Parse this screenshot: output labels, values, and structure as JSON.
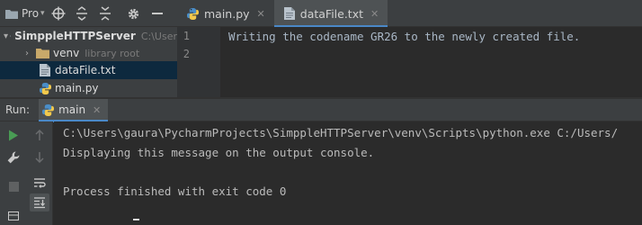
{
  "project_toolbar": {
    "label": "Pro",
    "icons": [
      "folder-icon",
      "crosshair-icon",
      "expand-all-icon",
      "collapse-all-icon",
      "gear-icon",
      "minimize-icon"
    ]
  },
  "editor_tabs": [
    {
      "label": "main.py",
      "icon": "python-file-icon",
      "active": false
    },
    {
      "label": "dataFile.txt",
      "icon": "text-file-icon",
      "active": true
    }
  ],
  "project_tree": {
    "root": {
      "name": "SimppleHTTPServer",
      "path": "C:\\User"
    },
    "items": [
      {
        "name": "venv",
        "hint": "library root"
      },
      {
        "name": "dataFile.txt",
        "selected": true
      },
      {
        "name": "main.py"
      }
    ]
  },
  "editor": {
    "line_numbers": [
      "1",
      "2"
    ],
    "lines": [
      "Writing the codename GR26 to the newly created file.",
      ""
    ]
  },
  "run_window": {
    "label": "Run:",
    "tab_name": "main",
    "console_lines": [
      "C:\\Users\\gaura\\PycharmProjects\\SimppleHTTPServer\\venv\\Scripts\\python.exe C:/Users/",
      "Displaying this message on the output console.",
      "",
      "Process finished with exit code 0"
    ]
  },
  "colors": {
    "background": "#2b2b2b",
    "panel": "#3c3f41",
    "accent": "#4a88c7",
    "selection": "#0d293e",
    "run_green": "#499c54"
  }
}
